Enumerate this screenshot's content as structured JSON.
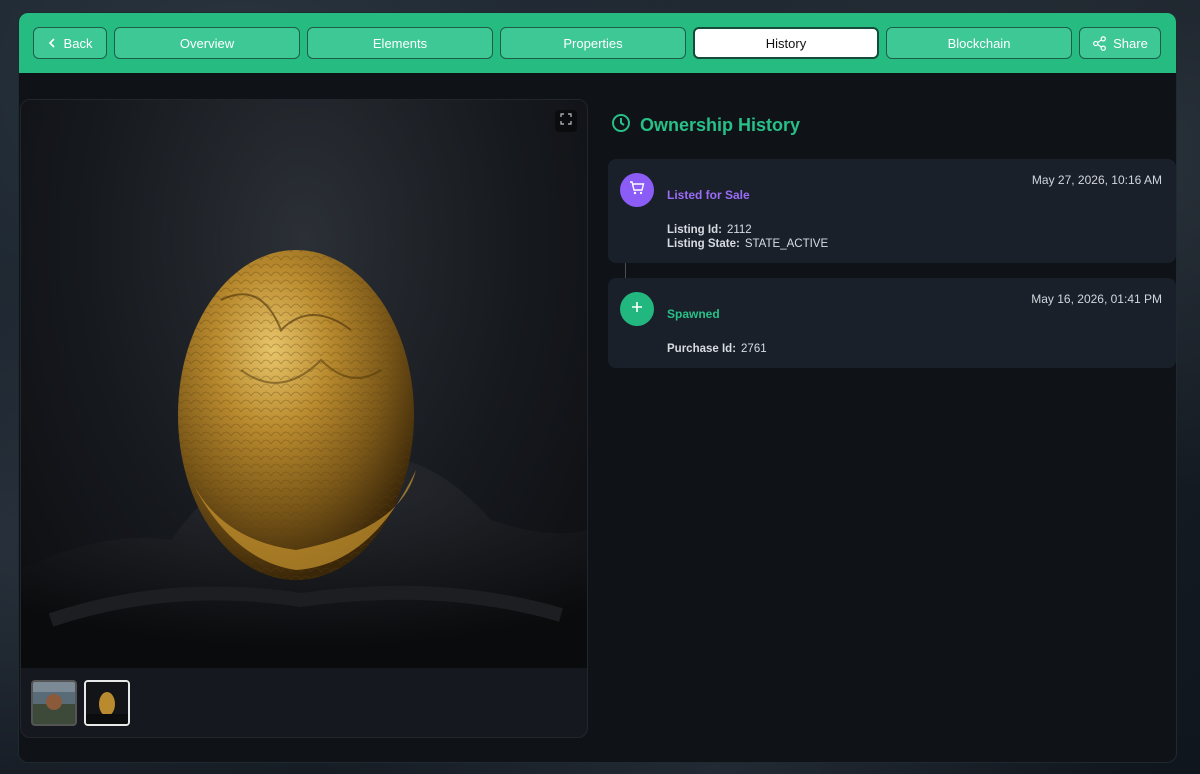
{
  "nav": {
    "back_label": "Back",
    "tabs": [
      {
        "label": "Overview"
      },
      {
        "label": "Elements"
      },
      {
        "label": "Properties"
      },
      {
        "label": "History",
        "active": true
      },
      {
        "label": "Blockchain"
      }
    ],
    "share_label": "Share"
  },
  "media": {
    "thumbnails": [
      {
        "name": "thumbnail-landscape",
        "active": false
      },
      {
        "name": "thumbnail-golden-egg",
        "active": true
      }
    ]
  },
  "history": {
    "title": "Ownership History",
    "events": [
      {
        "type": "Listed for Sale",
        "icon": "cart-icon",
        "color": "#8b5cf6",
        "timestamp": "May 27, 2026, 10:16 AM",
        "details": [
          {
            "label": "Listing Id:",
            "value": "2112"
          },
          {
            "label": "Listing State:",
            "value": "STATE_ACTIVE"
          }
        ]
      },
      {
        "type": "Spawned",
        "icon": "plus-icon",
        "color": "#22b77e",
        "timestamp": "May 16, 2026, 01:41 PM",
        "details": [
          {
            "label": "Purchase Id:",
            "value": "2761"
          }
        ]
      }
    ]
  },
  "colors": {
    "accent": "#26bb80",
    "title_green": "#27c087",
    "purple": "#8b5cf6",
    "card_bg": "#1a202a"
  }
}
